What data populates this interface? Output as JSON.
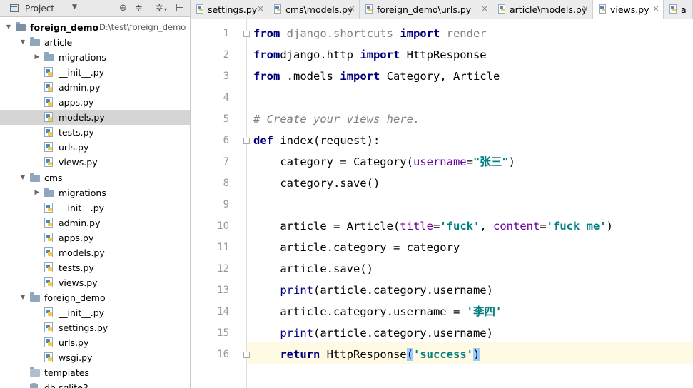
{
  "project_panel": {
    "title": "Project",
    "tools": [
      "target-icon",
      "collapse-icon",
      "gear-icon",
      "hide-icon"
    ],
    "tree": [
      {
        "label": "foreign_demo",
        "path": "D:\\test\\foreign_demo",
        "kind": "project",
        "expanded": true,
        "depth": 0
      },
      {
        "label": "article",
        "kind": "folder",
        "expanded": true,
        "depth": 1
      },
      {
        "label": "migrations",
        "kind": "folder",
        "expanded": false,
        "depth": 2
      },
      {
        "label": "__init__.py",
        "kind": "py",
        "depth": 2
      },
      {
        "label": "admin.py",
        "kind": "py",
        "depth": 2
      },
      {
        "label": "apps.py",
        "kind": "py",
        "depth": 2
      },
      {
        "label": "models.py",
        "kind": "py",
        "depth": 2,
        "selected": true
      },
      {
        "label": "tests.py",
        "kind": "py",
        "depth": 2
      },
      {
        "label": "urls.py",
        "kind": "py",
        "depth": 2
      },
      {
        "label": "views.py",
        "kind": "py",
        "depth": 2
      },
      {
        "label": "cms",
        "kind": "folder",
        "expanded": true,
        "depth": 1
      },
      {
        "label": "migrations",
        "kind": "folder",
        "expanded": false,
        "depth": 2
      },
      {
        "label": "__init__.py",
        "kind": "py",
        "depth": 2
      },
      {
        "label": "admin.py",
        "kind": "py",
        "depth": 2
      },
      {
        "label": "apps.py",
        "kind": "py",
        "depth": 2
      },
      {
        "label": "models.py",
        "kind": "py",
        "depth": 2
      },
      {
        "label": "tests.py",
        "kind": "py",
        "depth": 2
      },
      {
        "label": "views.py",
        "kind": "py",
        "depth": 2
      },
      {
        "label": "foreign_demo",
        "kind": "folder",
        "expanded": true,
        "depth": 1
      },
      {
        "label": "__init__.py",
        "kind": "py",
        "depth": 2
      },
      {
        "label": "settings.py",
        "kind": "py",
        "depth": 2
      },
      {
        "label": "urls.py",
        "kind": "py",
        "depth": 2
      },
      {
        "label": "wsgi.py",
        "kind": "py",
        "depth": 2
      },
      {
        "label": "templates",
        "kind": "template-folder",
        "depth": 1
      },
      {
        "label": "db.sqlite3",
        "kind": "db",
        "depth": 1
      }
    ]
  },
  "tabs": [
    {
      "label": "settings.py",
      "active": false
    },
    {
      "label": "cms\\models.py",
      "active": false
    },
    {
      "label": "foreign_demo\\urls.py",
      "active": false
    },
    {
      "label": "article\\models.py",
      "active": false
    },
    {
      "label": "views.py",
      "active": true
    },
    {
      "label": "a",
      "active": false
    }
  ],
  "editor": {
    "current_line": 16,
    "lines": [
      {
        "n": "1",
        "tokens": [
          [
            "kw",
            "from"
          ],
          [
            "dim",
            " django.shortcuts "
          ],
          [
            "kw",
            "import"
          ],
          [
            "dim",
            " render"
          ]
        ]
      },
      {
        "n": "2",
        "tokens": [
          [
            "kw",
            "from"
          ],
          [
            "",
            "django.http "
          ],
          [
            "kw",
            "import"
          ],
          [
            "",
            " HttpResponse"
          ]
        ]
      },
      {
        "n": "3",
        "tokens": [
          [
            "kw",
            "from"
          ],
          [
            "",
            " .models "
          ],
          [
            "kw",
            "import"
          ],
          [
            "",
            " Category, Article"
          ]
        ]
      },
      {
        "n": "4",
        "tokens": []
      },
      {
        "n": "5",
        "tokens": [
          [
            "cm",
            "# Create your views here."
          ]
        ]
      },
      {
        "n": "6",
        "tokens": [
          [
            "kw",
            "def"
          ],
          [
            "",
            " index(request):"
          ]
        ]
      },
      {
        "n": "7",
        "tokens": [
          [
            "",
            "    category = Category("
          ],
          [
            "prm",
            "username"
          ],
          [
            "",
            "="
          ],
          [
            "str",
            "\"张三\""
          ],
          [
            "",
            ")"
          ]
        ]
      },
      {
        "n": "8",
        "tokens": [
          [
            "",
            "    category.save()"
          ]
        ]
      },
      {
        "n": "9",
        "tokens": []
      },
      {
        "n": "10",
        "tokens": [
          [
            "",
            "    article = Article("
          ],
          [
            "prm",
            "title"
          ],
          [
            "",
            "="
          ],
          [
            "str",
            "'fuck'"
          ],
          [
            "",
            ", "
          ],
          [
            "prm",
            "content"
          ],
          [
            "",
            "="
          ],
          [
            "str",
            "'fuck me'"
          ],
          [
            "",
            ")"
          ]
        ]
      },
      {
        "n": "11",
        "tokens": [
          [
            "",
            "    article.category = category"
          ]
        ]
      },
      {
        "n": "12",
        "tokens": [
          [
            "",
            "    article.save()"
          ]
        ]
      },
      {
        "n": "13",
        "tokens": [
          [
            "fn",
            "    print"
          ],
          [
            "",
            "(article.category.username)"
          ]
        ]
      },
      {
        "n": "14",
        "tokens": [
          [
            "",
            "    article.category.username = "
          ],
          [
            "str",
            "'李四'"
          ]
        ]
      },
      {
        "n": "15",
        "tokens": [
          [
            "fn",
            "    print"
          ],
          [
            "",
            "(article.category.username)"
          ]
        ]
      },
      {
        "n": "16",
        "tokens": [
          [
            "kw",
            "    return"
          ],
          [
            "",
            " HttpResponse"
          ],
          [
            "brace",
            "("
          ],
          [
            "str",
            "'success'"
          ],
          [
            "brace",
            ")"
          ]
        ]
      }
    ]
  }
}
